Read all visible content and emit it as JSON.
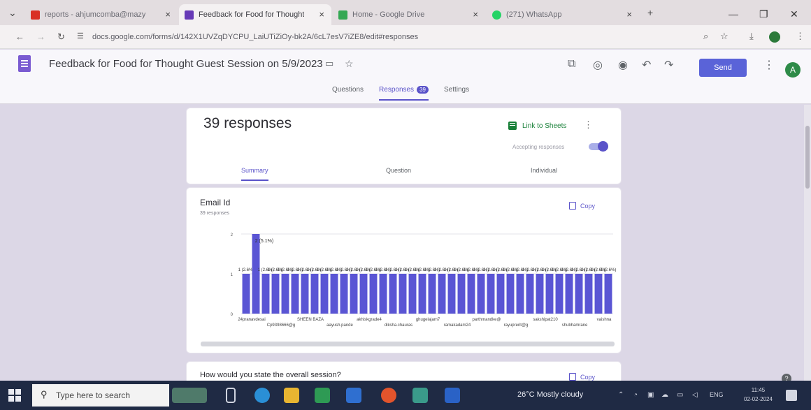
{
  "browser": {
    "tabs": [
      {
        "title": "reports - ahjumcomba@mazy",
        "favicon_color": "#d93025"
      },
      {
        "title": "Feedback for Food for Thought",
        "favicon_color": "#673ab7"
      },
      {
        "title": "Home - Google Drive",
        "favicon_color": "#34a853"
      },
      {
        "title": "(271) WhatsApp",
        "favicon_color": "#25d366"
      }
    ],
    "new_tab": "+",
    "url": "docs.google.com/forms/d/142X1UVZqDYCPU_LaiUTiZiOy-bk2A/6cL7esV7iZE8/edit#responses"
  },
  "form": {
    "title": "Feedback for Food for Thought Guest Session on 5/9/2023",
    "send_label": "Send",
    "avatar_letter": "A",
    "tabs": {
      "questions": "Questions",
      "responses": "Responses",
      "responses_count": "39",
      "settings": "Settings"
    }
  },
  "summary_card": {
    "count_label": "39 responses",
    "link_sheets": "Link to Sheets",
    "accepting": "Accepting responses",
    "subtabs": [
      "Summary",
      "Question",
      "Individual"
    ]
  },
  "email_card": {
    "title": "Email Id",
    "subtitle": "39 responses",
    "copy_label": "Copy"
  },
  "next_card": {
    "title": "How would you state the overall session?",
    "copy_label": "Copy"
  },
  "chart_data": {
    "type": "bar",
    "bar_color": "#5a55d4",
    "ylim": [
      0,
      2
    ],
    "yticks": [
      0,
      1,
      2
    ],
    "values": [
      1,
      2,
      1,
      1,
      1,
      1,
      1,
      1,
      1,
      1,
      1,
      1,
      1,
      1,
      1,
      1,
      1,
      1,
      1,
      1,
      1,
      1,
      1,
      1,
      1,
      1,
      1,
      1,
      1,
      1,
      1,
      1,
      1,
      1,
      1,
      1,
      1,
      1
    ],
    "top_label": "2 (5.1%)",
    "bar_label": "1 (2.6%)",
    "xlabels_row1": [
      "24pranavdesai",
      "SHEEN BAZA",
      "akhiskgrade4",
      "ghugelajam7",
      "parthmandke@",
      "sakshipat210",
      "vaishna"
    ],
    "xlabels_row2": [
      "Cp9398666@g",
      "aayush.pande",
      "diksha.chauras",
      "ramakadam24",
      "rayuprerit@g",
      "shubhamrane"
    ]
  },
  "taskbar": {
    "search_placeholder": "Type here to search",
    "weather": "26°C  Mostly cloudy",
    "lang": "ENG",
    "time": "11:45",
    "date": "02-02-2024"
  },
  "colors": {
    "accent": "#5a53c9",
    "sheets_green": "#188038",
    "taskbar": "#1f2a44"
  }
}
